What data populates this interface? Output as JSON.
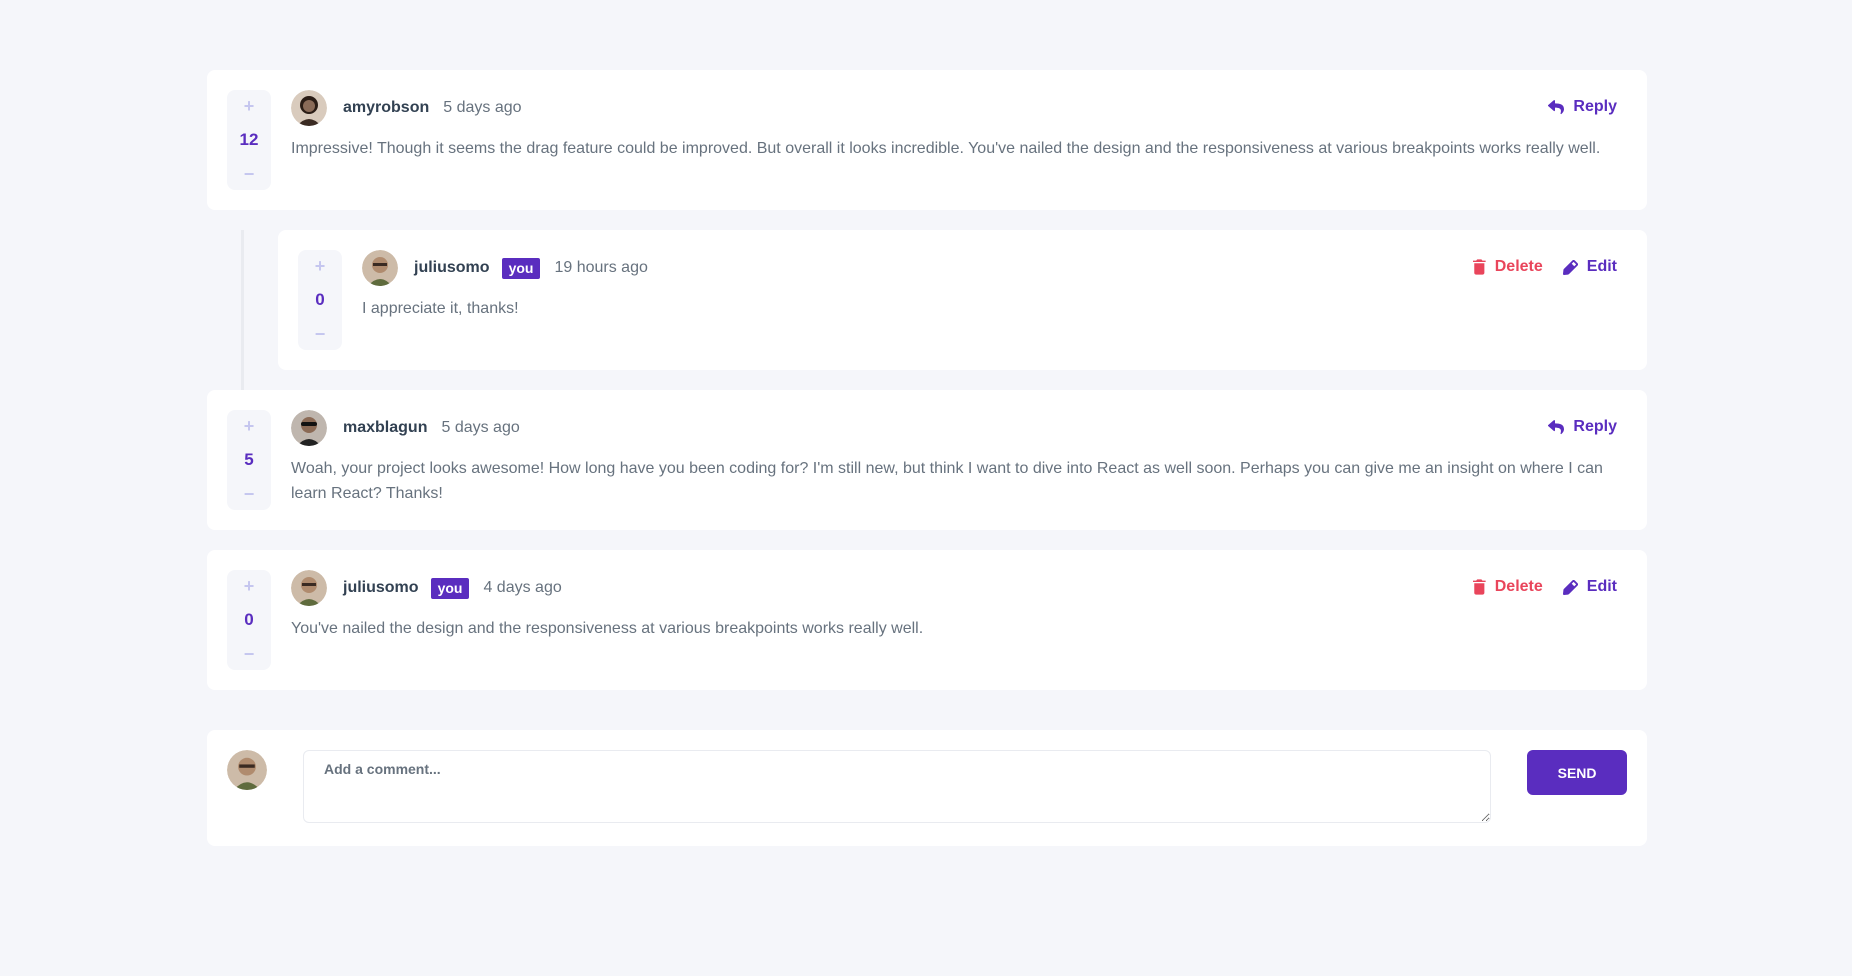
{
  "comments": [
    {
      "score": "12",
      "username": "amyrobson",
      "time": "5 days ago",
      "text": "Impressive! Though it seems the drag feature could be improved. But overall it looks incredible. You've nailed the design and the responsiveness at various breakpoints works really well.",
      "reply_label": "Reply",
      "avatar_color": "#8a6b58"
    },
    {
      "score": "5",
      "username": "maxblagun",
      "time": "5 days ago",
      "text": "Woah, your project looks awesome! How long have you been coding for? I'm still new, but think I want to dive into React as well soon. Perhaps you can give me an insight on where I can learn React? Thanks!",
      "reply_label": "Reply",
      "avatar_color": "#3b3b3b"
    },
    {
      "score": "0",
      "username": "juliusomo",
      "you_label": "you",
      "time": "4 days ago",
      "text": "You've nailed the design and the responsiveness at various breakpoints works really well.",
      "delete_label": "Delete",
      "edit_label": "Edit",
      "avatar_color": "#a88b70"
    }
  ],
  "reply": {
    "score": "0",
    "username": "juliusomo",
    "you_label": "you",
    "time": "19 hours ago",
    "text": "I appreciate it, thanks!",
    "delete_label": "Delete",
    "edit_label": "Edit"
  },
  "vote": {
    "plus": "+",
    "minus": "−"
  },
  "composer": {
    "placeholder": "Add a comment...",
    "send_label": "SEND"
  },
  "colors": {
    "primary": "#5a2dbf",
    "danger": "#e9455b",
    "background": "#f5f6fa"
  },
  "icons": {
    "reply": "reply-icon",
    "delete": "trash-icon",
    "edit": "pencil-icon"
  }
}
